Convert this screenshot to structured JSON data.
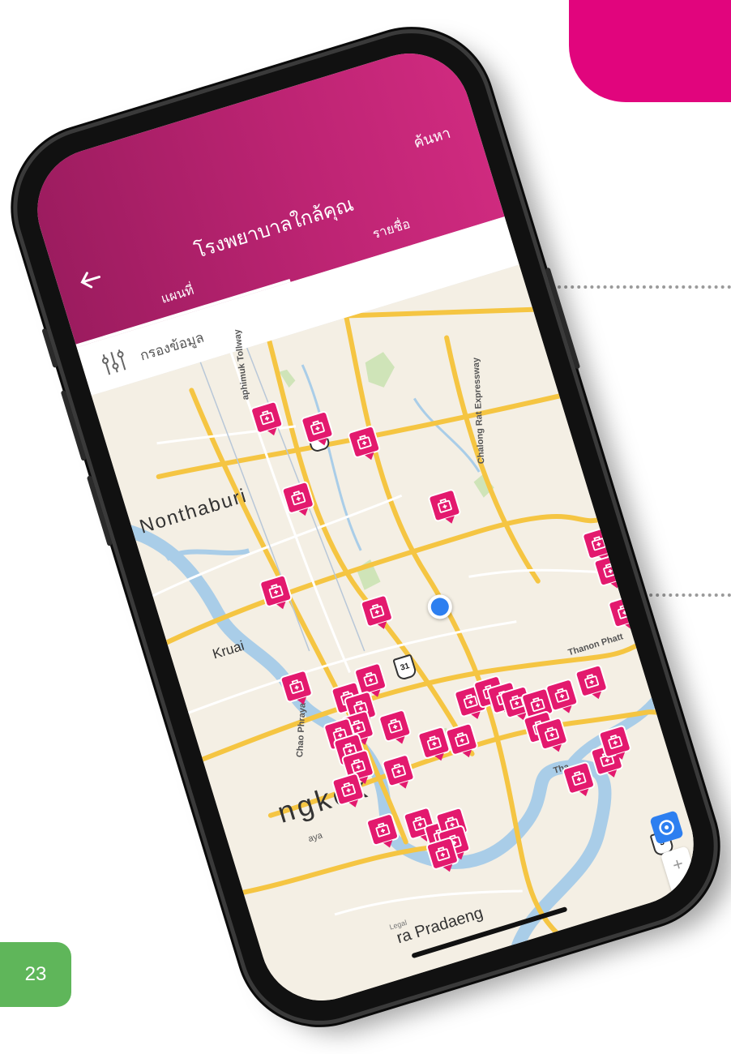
{
  "page": {
    "number": "23"
  },
  "colors": {
    "accent": "#e1057d",
    "appbar": "#bd2473",
    "pin": "#e3196e",
    "badge": "#5fb65a",
    "user_dot": "#2d7ff0"
  },
  "app": {
    "title": "โรงพยาบาลใกล้คุณ",
    "search_label": "ค้นหา",
    "back_icon": "arrow-left-icon",
    "tabs": [
      {
        "label": "แผนที่",
        "active": true
      },
      {
        "label": "รายชื่อ",
        "active": false
      }
    ],
    "filter": {
      "label": "กรองข้อมูล",
      "icon": "sliders-icon"
    }
  },
  "map": {
    "places": {
      "nonthaburi": "Nonthaburi",
      "kruai": "Kruai",
      "bangkok": "ngkok",
      "pradaeng": "ra Pradaeng",
      "legal": "Legal"
    },
    "roads": {
      "tollway": "aphimuk Tollway",
      "chalong": "Chalong Rat Expressway",
      "phatthanakan": "Thanon Phatt",
      "thanon": "Tha",
      "chao_phraya": "Chao Phraya",
      "phraya_label": "aya"
    },
    "highways": [
      "",
      "31",
      "3"
    ],
    "pin_icon": "hospital-icon",
    "pin_count": 41,
    "controls": {
      "zoom_in": "+",
      "zoom_out": "−",
      "locate_icon": "crosshair-icon"
    }
  }
}
